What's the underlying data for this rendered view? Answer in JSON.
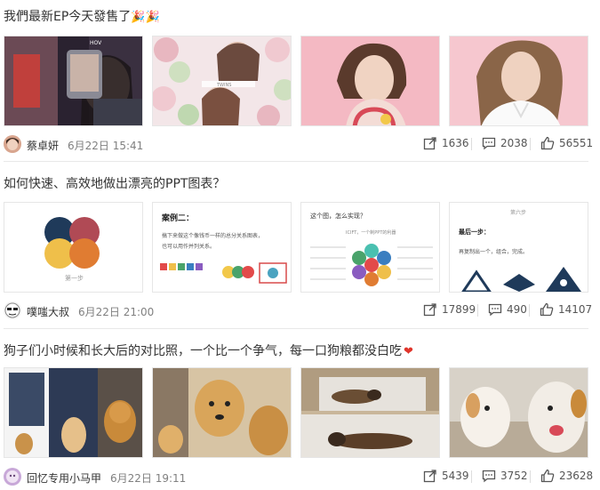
{
  "posts": [
    {
      "title": "我們最新EP今天發售了",
      "title_emoji": "🎉🎉",
      "author": "蔡卓妍",
      "date": "6月22日 15:41",
      "shares": "1636",
      "comments": "2038",
      "likes": "56551"
    },
    {
      "title": "如何快速、高效地做出漂亮的PPT图表？",
      "author": "噗嗤大叔",
      "date": "6月22日 21:00",
      "shares": "17899",
      "comments": "490",
      "likes": "14107",
      "slides": {
        "s1_caption": "第一步",
        "s2_title": "案例二：",
        "s2_line1": "搞下来做这个像钱币一样的总分关系图表，",
        "s2_line2": "也可以用作并列关系。",
        "s3_title": "这个图，怎么实现？",
        "s3_sub": "ICIFT，一个制PPT的利器",
        "s4_tab": "第六步",
        "s4_title": "最后一步：",
        "s4_line": "再复制出一个，组合，完成。"
      }
    },
    {
      "title": "狗子们小时候和长大后的对比照，一个比一个争气，每一口狗粮都没白吃",
      "title_emoji": "❤",
      "author": "回忆专用小马甲",
      "date": "6月22日 19:11",
      "shares": "5439",
      "comments": "3752",
      "likes": "23628"
    }
  ],
  "colors": {
    "divider": "#e8e8e8",
    "heart": "#e0352b",
    "circle_navy": "#1f3a5a",
    "circle_rose": "#b04a55",
    "circle_yellow": "#efbf4a",
    "circle_orange": "#e07c32"
  },
  "icons": [
    "share-icon",
    "comment-icon",
    "like-icon"
  ]
}
